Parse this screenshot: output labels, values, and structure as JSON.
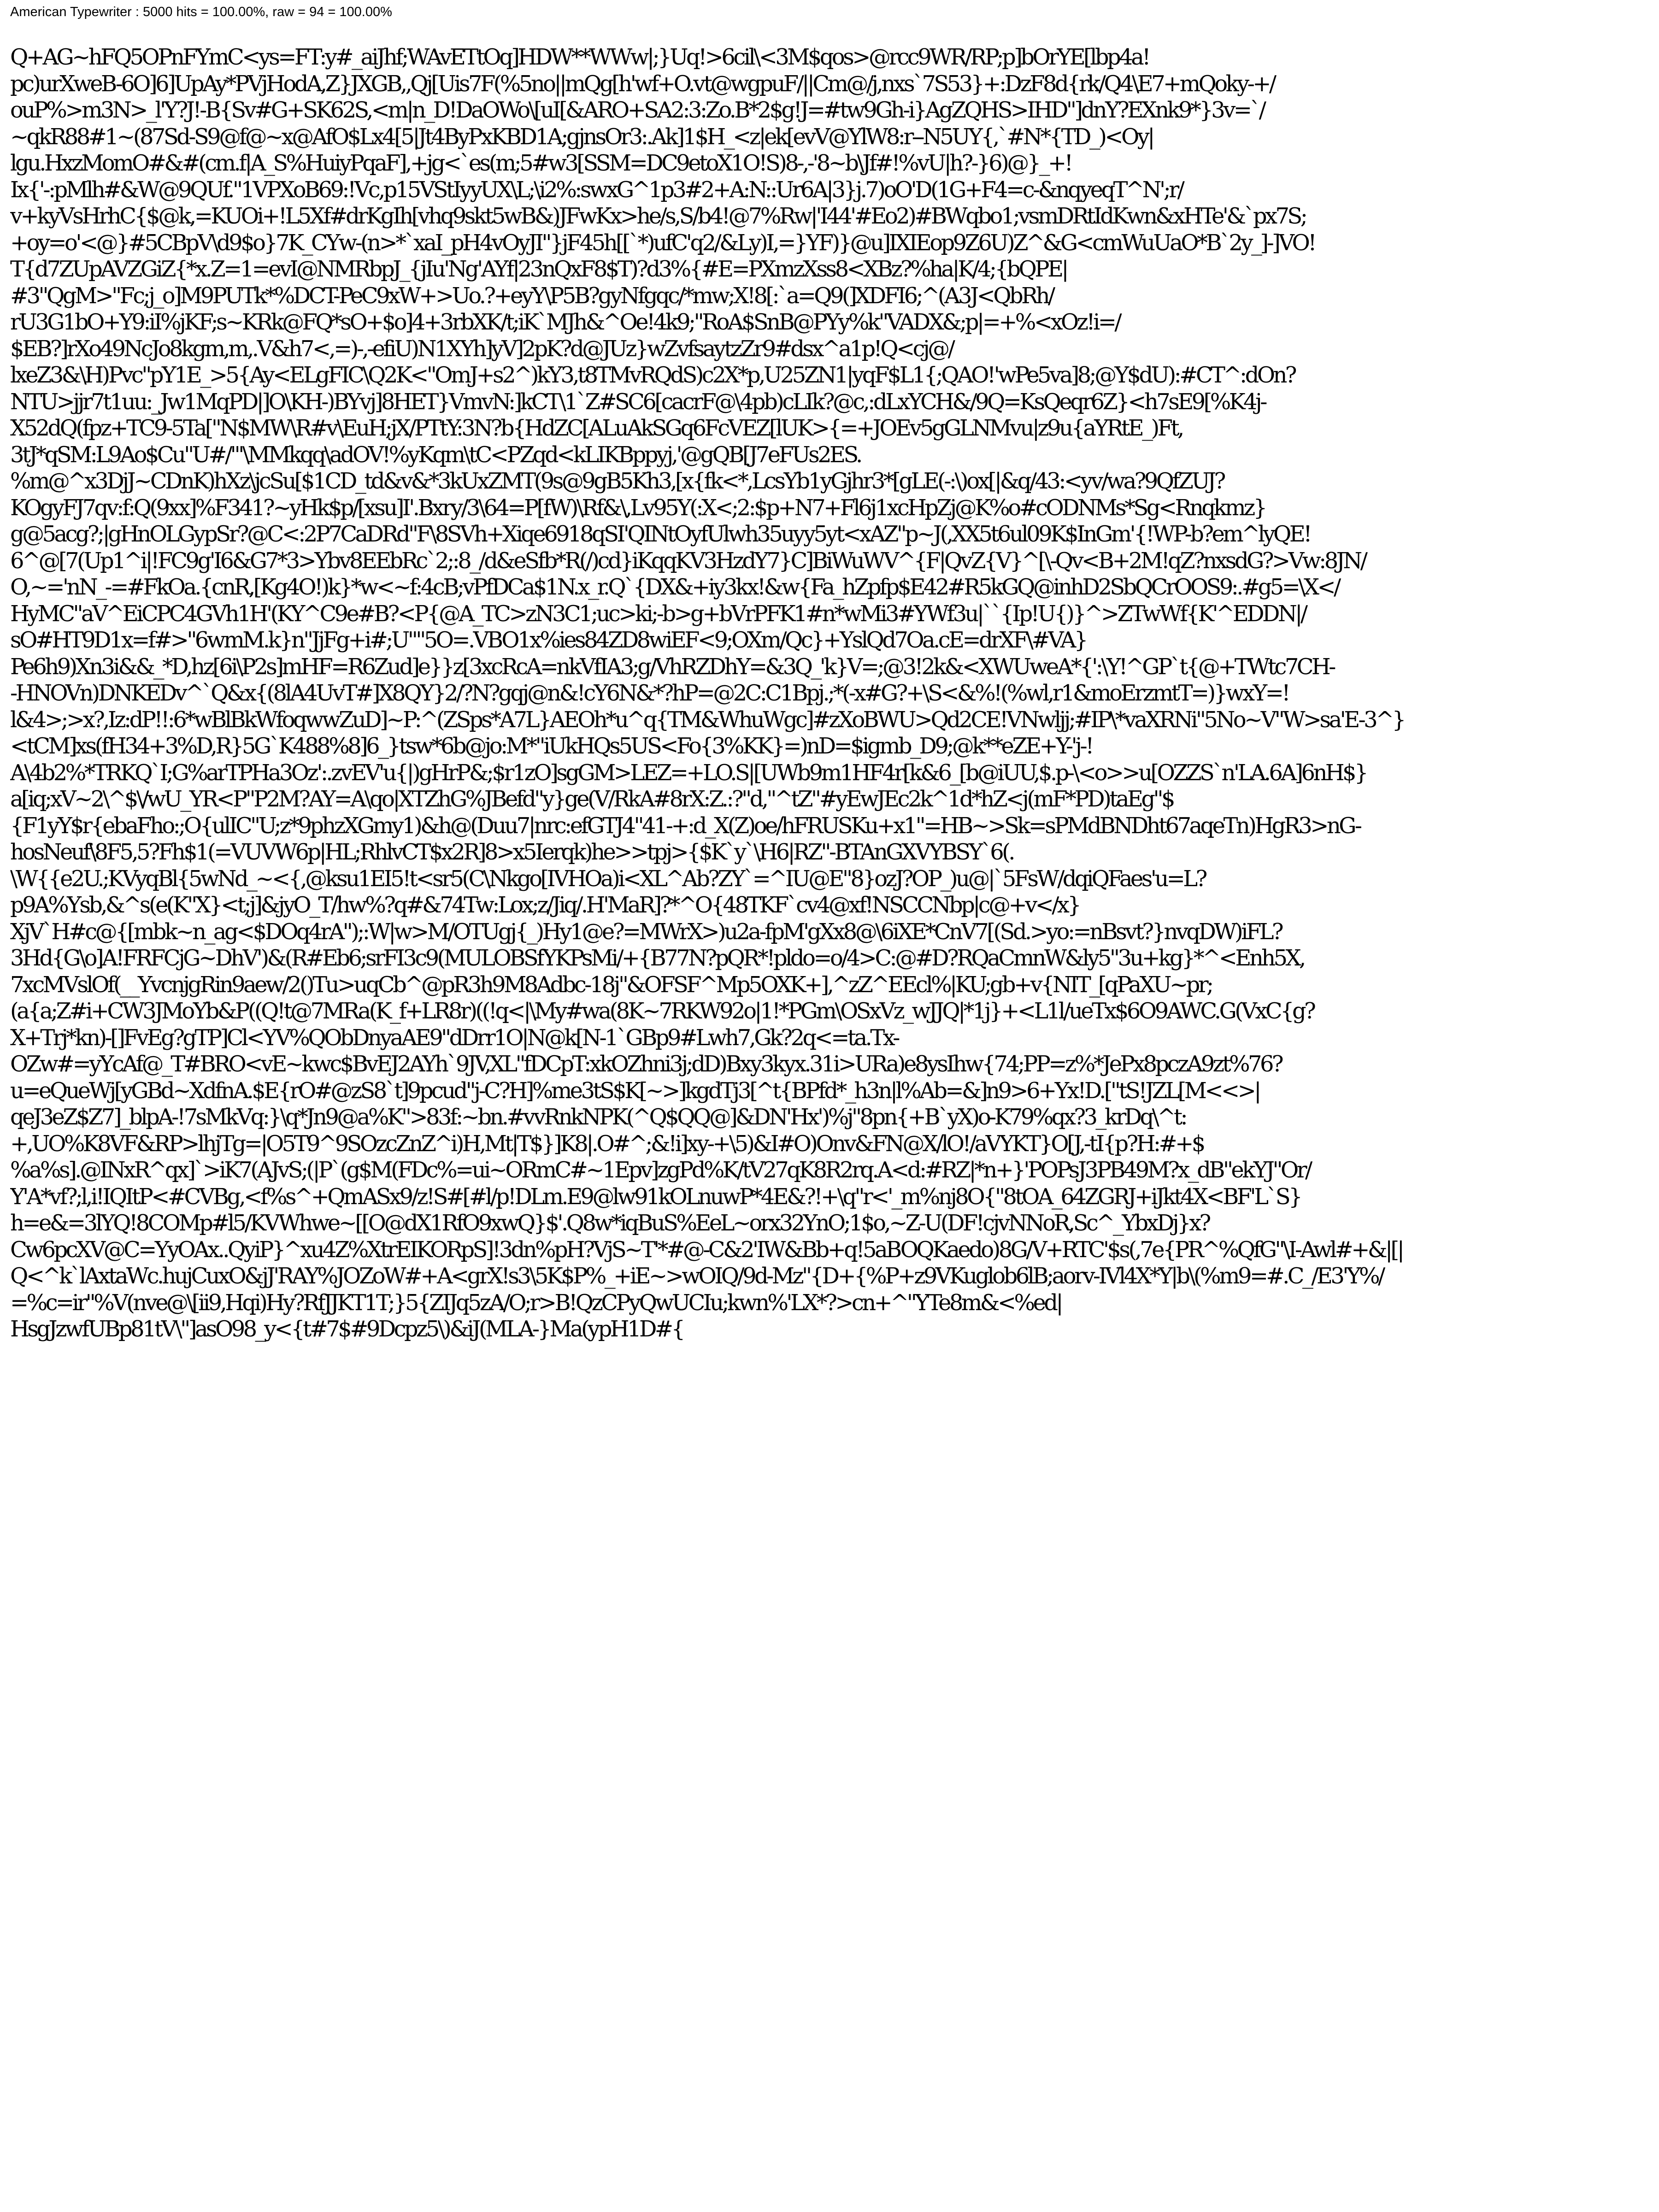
{
  "header": {
    "text": "American Typewriter : 5000 hits = 100.00%, raw = 94 = 100.00%"
  },
  "body": {
    "lines": [
      "Q+AG~hFQ5OPnFYmC<ys=FT:y#_aiJhf;WAvETtOq]HDW**WWw|;}Uq!>6cil\\<3M$qos>@rcc9WR/RP;p]bOrYE[lbp4a!",
      "pc)urXweB-6O]6]UpAy*PVjHodA,Z}JXGB,,Qj[Uis7F(%5no||mQg[h'wf+O.vt@wgpuF/||Cm@/j,nxs`7S53}+:DzF8d{rk/Q4\\E7+mQoky-+/",
      "ouP%>m3N>_l'Y?J!-B{Sv#G+SK62S,<m|n_D!DaOWo\\[uI[&ARO+SA2:3:Zo.B*2$g!J=#tw9Gh-i}AgZQHS>IHD\"]dnY?EXnk9*}3v=`/",
      "~qkR88#1~(87Sd-S9@f@~x@AfO$Lx4[5|Jt4ByPxKBD1A;gjnsOr3:.Ak]1$H_<z|ek[evV@YlW8:r--N5UY{,`#N*{TD_)<Oy|",
      "lgu.HxzMomO#&#(cm.f|A_S%HuiyPqaF],+jg<`es(m;5#w3[SSM=DC9etoX1O!S)8-,-'8~b\\Jf#!%vU|h?-}6)@}_+!",
      "Ix{'-:pMlh#&W@9QUf.\"1VPXoB69:!Vc,p15VStIyyUX\\L;\\i2%:swxG^1p3#2+A:N::Ur6A|3}j.7)oO'D(1G+F4=c-&nqyeqT^N';r/",
      "v+kyVsHrhC{$@k,=KUOi+!L5Xf#drKgIh[vhq9skt5wB&)JFwKx>he/s,S/b4!@7%Rw|'I44'#Eo2)#BWqbo1;vsmDRtIdKwn&xHTe'&`px7S;",
      "+oy=o'<@}#5CBpV\\d9$o}7K_CYw-(n>*`xaI_pH4vOyJI\"}jF45h[[`*)ufC'q2/&Ly)I,=}YF)}@u]IXIEop9Z6U)Z^&G<cmWuUaO*B`2y_]-]VO!",
      "T{d7ZUpAVZGiZ{*x.Z=1=evI@NMRbpJ_{jIu'Ng'AYf|23nQxF8$T)?d3%{#E=PXmzXss8<XBz?%ha|K/4;{bQPE|",
      "#3\"QgM>\"Fc;j_o]M9PUTk*%DCT-PeC9xW+>Uo.?+eyY\\P5B?gyNfgqc/*mw;X!8[:`a=Q9(]XDFI6;^(A3J<QbRh/",
      "rU3G1bO+Y9:iI%jKF;s~KRk@FQ*sO+$o]4+3rbXK/t;iK`MJh&^Oe!4k9;\"RoA$SnB@PYy%k\"VADX&;p|=+%<xOz!i=/",
      "$EB?]rXo49NcJo8kgm,m,.V&h7<,=)-,-efiU)N1XYh]yV]2pK?d@JUz}wZvfsaytzZr9#dsx^a1p!Q<cj@/",
      "lxeZ3&\\H)Pvc\"pY1E_>5{Ay<ELgFIC\\Q2K<\"OmJ+s2^)kY3,t8TMvRQdS)c2X*p,U25ZN1|yqF$L1{;QAO!'wPe5va]8;@Y$dU):#CT^:dOn?",
      "NTU>jjr7t1uu:_Jw1MqPD|]O\\KH-)BYvj]8HET}VmvN:]kCT\\1`Z#SC6[cacrF@\\4pb)cLIk?@c,:dLxYCH&/9Q=KsQeqr6Z}<h7sE9[%K4j-",
      "X52dQ(fpz+TC9-5Ta[\"N$MW\\R#v\\EuH;jX/PTtY:3N?b{HdZC[ALuAkSGq6FcVEZ[lUK>{=+JOEv5gGLNMvu|z9u{aYRtE_)Ft,",
      "3tJ*qSM:L9Ao$Cu\"U#/\"'\\MMkqq\\adOV!%yKqm\\tC<PZqd<kLIKBppyj,'@gQB[J7eFUs2ES.",
      "%m@^x3DjJ~CDnK)hXz\\jcSu[$1CD_td&v&*3kUxZMT(9s@9gB5Kh3,[x{fk<*,LcsYb1yGjhr3*[gLE(-:\\)ox[|&q/43:<yv/wa?9QfZUJ?",
      "KOgyFJ7qv:f:Q(9xx]%F341?~yHk$p/[xsu]I'.Bxry/3\\64=P[fW)\\Rf&\\,Lv95Y(:X<;2:$p+N7+Fl6j1xcHpZj@K%o#cODNMs*Sg<Rnqkmz}",
      "g@5acg?;|gHnOLGypSr?@C<:2P7CaDRd\"F\\8SVh+Xiqe6918qSI'QINtOyfUlwh35uyy5yt<xAZ\"p~J(,XX5t6ul09K$InGm'{!WP-b?em^lyQE!",
      "6^@[7(Up1^i|!FC9g'I6&G7*3>Ybv8EEbRc`2;:8_/d&eSfb*R(/)cd}iKqqKV3HzdY7}C]BiWuWV^{F|QvZ{V}^[\\-Qv<B+2M!qZ?nxsdG?>Vw:8JN/",
      "O,~='nN_-=#FkOa.{cnR,[Kg4O!)k}*w<~f:4cB;vPfDCa$1N.x_r.Q`{DX&+iy3kx!&w{Fa_hZpfp$E42#R5kGQ@inhD2SbQCrOOS9:.#g5=\\X</",
      "HyMC\"aV^EiCPC4GVh1H'(KY^C9e#B?<P{@A_TC>zN3C1;uc>ki;-b>g+bVrPFK1#n*wMi3#YWf3u|``{Ip!U{)}^>ZTwWf{K'^EDDN|/",
      "sO#HT9D1x=f#>\"6wmM.k}n\"JjFg+i#;U\"\"5O=.VBO1x%ies84ZD8wiEF<9;OXm/Qc}+YslQd7Oa.cE=drXF\\#VA}",
      "Pe6h9)Xn3i&&_*D,hz[6i\\P2s]mHF=R6Zud]e}}z[3xcRcA=nkVfIA3;g/VhRZDhY=&3Q_'k}V=;@3!2k&<XWUweA*{':\\Y!^GP`t{@+TWtc7CH-",
      "-HNOVn)DNKEDv^`Q&x{(8lA4UvT#]X8QY}2/?N?gqj@n&!cY6N&*?hP=@2C:C1Bpj.;*(-x#G?+\\S<&%!(%wl,r1&moErzmtT=)}wxY=!",
      "l&4>;>x?,Iz:dP!!:6*wBlBkWfoqwwZuD]~P:^(ZSps*A7L}AEOh*u^q{TM&WhuWgc]#zXoBWU>Qd2CE!VNwljj;#IP\\*vaXRNi\"5No~V\"W>sa'E-3^}",
      "<tCM]xs(fH34+3%D,R}5G`K488%8]6_}tsw*6b@jo:M*\"iUkHQs5US<Fo{3%KK}=)nD=$igmb_D9;@k**eZE+Y-'j-!",
      "A\\4b2%*TRKQ`I;G%arTPHa3Oz':.zvEV'u{|)gHrP&;$r1zO]sgGM>LEZ=+LO.S|[UWb9m1HF4r[k&6_[b@iUU,$.p-\\<o>>u[OZZS`n'LA.6A]6nH$}",
      "a[iq;xV~2\\^$\\/wU_YR<P\"P2M?AY=A\\qo|XTZhG%JBefd\"y}ge(V/RkA#8rX:Z.:?\"d,\"^tZ\"#yEwJEc2k^1d*hZ<j(mF*PD)taEg\"$",
      "{F1yY$r{ebaFho:;O{ulIC\"U;z*9phzXGmy1)&h@(Duu7|nrc:efGTJ4\"41-+:d_X(Z)oe/hFRUSKu+x1\"=HB~>Sk=sPMdBNDht67aqeTn)HgR3>nG-",
      "hosNeuf\\8F5,5?Fh$1(=VUVW6p|HL;RhlvCT$x2R]8>x5Ierqk)he>>tpj>{$K`y`\\H6|RZ\"-BTAnGXVYBSY`6(.",
      "\\W{{e2U.;KVyqBl{5wNd_~<{,@ksu1EI5!t<sr5(C\\Nkgo[IVHOa)i<XL^Ab?ZY`=^IU@E\"8}ozJ?OP_)u@|`5FsW/dqiQFaes'u=L?",
      "p9A%Ysb,&^s(e(K\"X}<t;j]&jyO_T/hw%?q#&74Tw:Lox;z/Jiq/.H'MaR]?*^O{48TKF`cv4@xf!NSCCNbp|c@+v</x}",
      "XjV`H#c@{[mbk~n_ag<$DOq4rA\");:W|w>M/OTUgj{_)Hy1@e?=MWrX>)u2a-fpM'gXx8@\\6iXE*CnV7[(Sd.>yo:=nBsvt?}nvqDW)iFL?",
      "3Hd{G\\o]A!FRFCjG~DhV')&(R#Eb6;srFI3c9(MULOBSfYKPsMi/+{B77N?pQR*!pldo=o/4>C:@#D?RQaCmnW&ly5\"3u+kg}*^<Enh5X,",
      "7xcMVslOf(__YvcnjgRin9aew/2()Tu>uqCb^@pR3h9M8Adbc-18j\"&OFSF^Mp5OXK+],^zZ^EEcl%|KU;gb+v{NIT_[qPaXU~pr;",
      "(a{a;Z#i+CW3JMoYb&P((Q!t@7MRa(K_f+LR8r)((!q<|\\My#wa(8K~7RKW92o|1!*PGm\\OSxVz_wJJQ|*1j}+<L1l/ueTx$6O9AWC.G(VxC{g?",
      "X+Trj*kn)-[]FvEg?gTP]Cl<YV%QObDnyaAE9\"dDrr1O|N@k[N-1`GBp9#Lwh7,Gk?2q<=ta.Tx-",
      "OZw#=yYcAf@_T#BRO<vE~kwc$BvEJ2AYh`9JV,XL\"fDCpT:xkOZhni3j;dD)Bxy3kyx.31i>URa)e8ysIhw{74;PP=z%*JePx8pczA9zt%76?",
      "u=eQueWj[yGBd~XdfnA.$E{rO#@zS8`t]9pcud\"j-C?H]%me3tS$K[~>]kgdTj3[^t{BPfd*_h3n|l%Ab=&]n9>6+Yx!D.[\"tS!JZL[M<<>|",
      "qeJ3eZ$Z7]_blpA-!7sMkVq:}\\q*Jn9@a%K\">83f:~bn.#vvRnkNPK(^Q$QQ@]&DN'Hx')%j\"8pn{+B`yX)o-K79%qx?3_krDq\\^t:",
      "+,UO%K8VF&RP>lhjTg=|O5T9^9SOzcZnZ^i)H,Mt|T$}]K8|.O#^;&!i]xy-+\\5)&I#O)Onv&FN@X/lO!/aVYKT}O[J,-tI{p?H:#+$",
      "%a%s].@INxR^qx]`>iK7(AJvS;(|P`(g$M(FDc%=ui~ORmC#~1Epv]zgPd%K/tV27qK8R2rq.A<d:#RZ|*n+}'POPsJ3PB49M?x_dB\"ekYJ\"Or/",
      "Y'A*vf?;l,i!IQItP<#CVBg,<f%s^+QmASx9/z!S#[#l/p!DLm.E9@lw91kOLnuwP*4E&?!+\\q\"r<'_m%nj8O{\"8tOA_64ZGRJ+iJkt4X<BF'L`S}",
      "h=e&=3lYQ!8COMp#l5/KVWhwe~[[O@dX1RfO9xwQ}$'.Q8w*iqBuS%EeL~orx32YnO;1$o,~Z-U(DF!cjvNNoR,Sc^_YbxDj}x?",
      "Cw6pcXV@C=YyOAx..QyiP}^xu4Z%XtrEIKORpS]!3dn%pH?VjS~T'*#@-C&2'IW&Bb+q!5aBOQKaedo)8G/V+RTC'$s(,7e{PR^%QfG\"\\I-Awl#+&|[|",
      "Q<^k`lAxtaWc.hujCuxO&jJ'RAY%JOZoW#+A<grX!s3\\5K$P%_+iE~>wOIQ/9d-Mz\"{D+{%P+z9VKuglob6lB;aorv-IVl4X*Y|b\\(%m9=#.C_/E3'Y%/",
      "=%c=ir\"%V(nve@\\[ii9,Hqi)Hy?RfJJKT1T;}5{ZIJq5zA/O;r>B!QzCPyQwUCIu;kwn%'LX*?>cn+^\"YTe8m&<%ed|",
      "HsgJzwfUBp81tV\\\"]asO98_y<{t#7$#9Dcpz5\\)&iJ(MLA-}Ma(ypH1D#{"
    ]
  }
}
